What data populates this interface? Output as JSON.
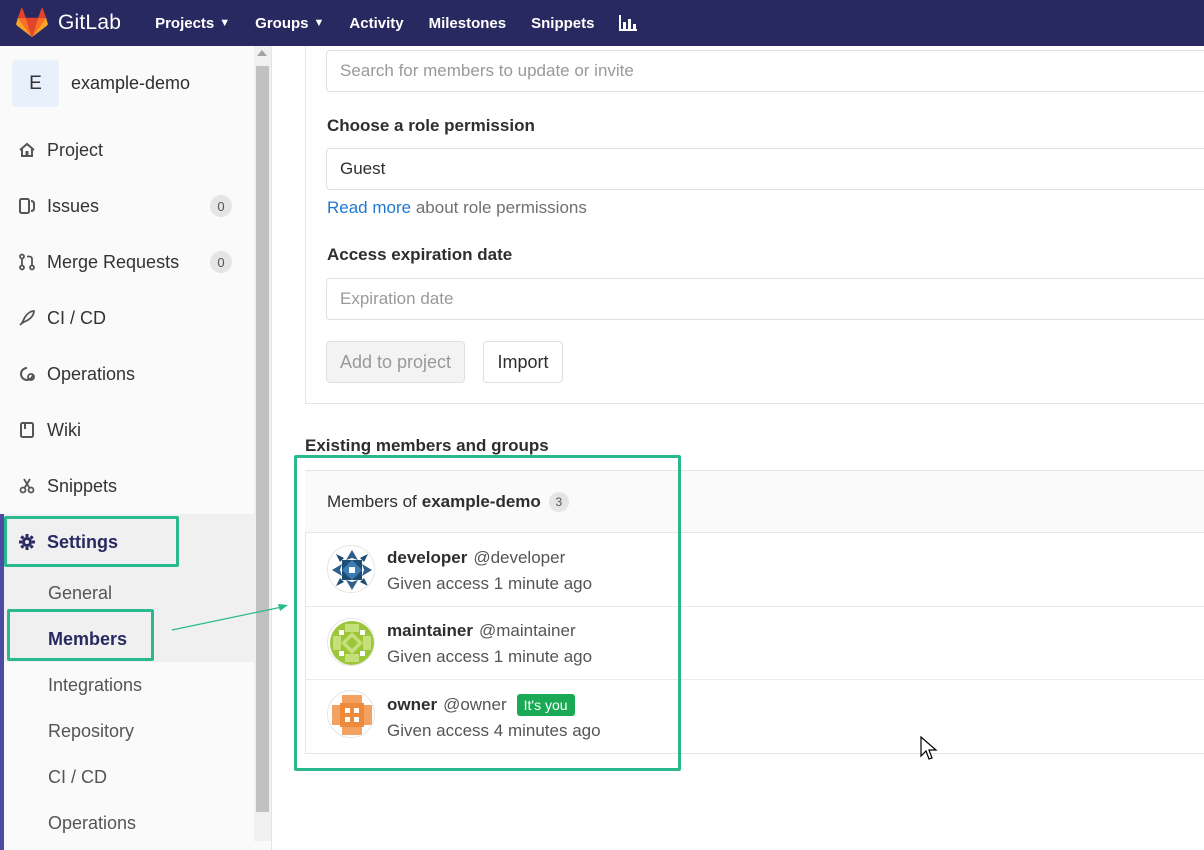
{
  "navbar": {
    "brand": "GitLab",
    "items": [
      {
        "label": "Projects",
        "dropdown": true
      },
      {
        "label": "Groups",
        "dropdown": true
      },
      {
        "label": "Activity",
        "dropdown": false
      },
      {
        "label": "Milestones",
        "dropdown": false
      },
      {
        "label": "Snippets",
        "dropdown": false
      }
    ],
    "chart_icon": "chart-icon"
  },
  "sidebar": {
    "project_avatar": "E",
    "project_name": "example-demo",
    "items": [
      {
        "label": "Project",
        "icon": "home-icon"
      },
      {
        "label": "Issues",
        "icon": "issues-icon",
        "count": "0"
      },
      {
        "label": "Merge Requests",
        "icon": "merge-request-icon",
        "count": "0"
      },
      {
        "label": "CI / CD",
        "icon": "rocket-icon"
      },
      {
        "label": "Operations",
        "icon": "operations-icon"
      },
      {
        "label": "Wiki",
        "icon": "book-icon"
      },
      {
        "label": "Snippets",
        "icon": "scissors-icon"
      },
      {
        "label": "Settings",
        "icon": "gear-icon"
      }
    ],
    "settings_subitems": [
      "General",
      "Members",
      "Integrations",
      "Repository",
      "CI / CD",
      "Operations"
    ]
  },
  "form": {
    "search_placeholder": "Search for members to update or invite",
    "role_label": "Choose a role permission",
    "role_value": "Guest",
    "read_more_link": "Read more",
    "read_more_suffix": " about role permissions",
    "expiration_label": "Access expiration date",
    "expiration_placeholder": "Expiration date",
    "add_button": "Add to project",
    "import_button": "Import"
  },
  "members": {
    "section_title": "Existing members and groups",
    "panel_prefix": "Members of",
    "panel_project": "example-demo",
    "count": "3",
    "list": [
      {
        "name": "developer",
        "handle": "@developer",
        "access": "Given access 1 minute ago"
      },
      {
        "name": "maintainer",
        "handle": "@maintainer",
        "access": "Given access 1 minute ago"
      },
      {
        "name": "owner",
        "handle": "@owner",
        "badge": "It's you",
        "access": "Given access 4 minutes ago"
      }
    ]
  },
  "colors": {
    "navbar": "#292961",
    "highlight": "#2ab98e",
    "link": "#1f78d1",
    "badge_green": "#1aaa55"
  }
}
